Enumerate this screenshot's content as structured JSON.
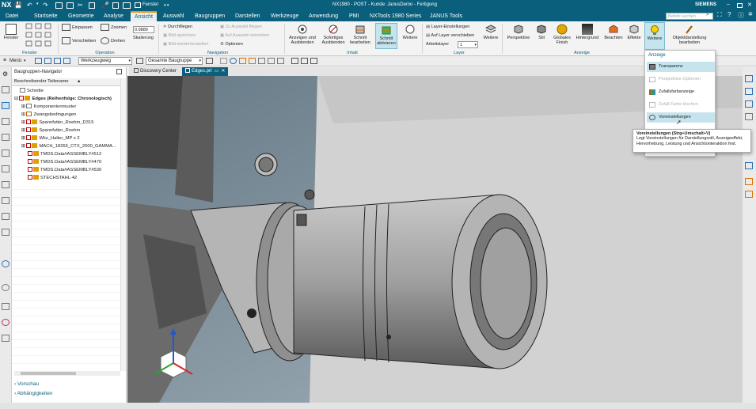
{
  "app": {
    "logo": "NX",
    "title": "NX1980 - POST - Kunde: JanusDemo - Fertigung",
    "brand": "SIEMENS",
    "window_menu": "Fenster"
  },
  "menu": [
    "Datei",
    "Startseite",
    "Geometrie",
    "Analyse",
    "Ansicht",
    "Auswahl",
    "Baugruppen",
    "Darstellen",
    "Werkzeuge",
    "Anwendung",
    "PMI",
    "NXTools 1980 Series",
    "JANUS Tools"
  ],
  "active_menu": "Ansicht",
  "search": {
    "placeholder": "Befehl suchen"
  },
  "ribbon": {
    "fenster": "Fenster",
    "einpassen": "Einpassen",
    "verschieben": "Verschieben",
    "zoomen": "Zoomen",
    "drehen": "Drehen",
    "skalierung_value": "0.9889",
    "skalierung": "Skalierung",
    "durchfliegen": "Durchfliegen",
    "bild_speichern": "Bild speichern",
    "bild_wiederherstellen": "Bild wiederherstellen",
    "zu_auswahl_fliegen": "Zu Auswahl fliegen",
    "auf_auswahl_einrichten": "Auf Auswahl einrichten",
    "optionen": "Optionen",
    "anzeigen_ausblenden": "Anzeigen und Ausblenden",
    "sofortiges_ausblenden": "Sofortiges Ausblenden",
    "schnitt_bearbeiten": "Schnitt bearbeiten",
    "schnitt_aktivieren": "Schnitt aktivieren",
    "weitere": "Weitere",
    "layer_einstellungen": "Layer-Einstellungen",
    "auf_layer_verschieben": "Auf Layer verschieben",
    "arbeitslayer": "Arbeitslayer",
    "arbeitslayer_value": "1",
    "perspektive": "Perspektive",
    "stil": "Stil",
    "globales_finish": "Globales Finish",
    "hintergrund": "Hintergrund",
    "beachten": "Beachten",
    "effekte": "Effekte",
    "weitere2": "Weitere",
    "objektdarstellung": "Objektdarstellung bearbeiten",
    "groups": {
      "fenster": "Fenster",
      "operation": "Operation",
      "navigation": "Navigation",
      "inhalt": "Inhalt",
      "layer": "Layer",
      "anzeige": "Anzeige"
    }
  },
  "toolbar2": {
    "menu": "Menü",
    "filter": "Werkzeugweg",
    "scope": "Gesamte Baugruppe"
  },
  "tabs": [
    {
      "label": "Discovery Center"
    },
    {
      "label": "Edges.prt"
    }
  ],
  "navigator": {
    "title": "Baugruppen-Navigator",
    "column": "Beschreibender Teilename",
    "rows": [
      "Schnitte",
      "Edges (Reihenfolge: Chronologisch)",
      "Komponentenmuster",
      "Zwangsbedingungen",
      "Spannfutter_Roehm_D315",
      "Spannfutter_Roehm",
      "Wkz_Halter_MP x 2",
      "MACH_18265_CTX_2000_GAMMA...",
      "TMDS.Data#ASSEMBLY#512",
      "TMDS.Data#ASSEMBLY#470",
      "TMDS.Data#ASSEMBLY#530",
      "STECHSTAHL-42"
    ],
    "vorschau": "Vorschau",
    "abhaengigkeiten": "Abhängigkeiten"
  },
  "popup": {
    "title": "Anzeige",
    "items": [
      "Transparenz",
      "Perspektive-Optionen",
      "Zufallsfarbanzeige",
      "Zufall Farbe löschen",
      "Voreinstellungen"
    ]
  },
  "tooltip": {
    "title": "Voreinstellungen (Strg+Umschalt+V)",
    "body": "Legt Voreinstellungen für Darstellungsstil, Anzeigeeffekt, Hervorhebung, Leistung und Ansichtsinteraktion fest."
  },
  "colors": {
    "accent": "#0a5f7c",
    "highlight": "#f39200",
    "viewport": "#7d8d98"
  }
}
